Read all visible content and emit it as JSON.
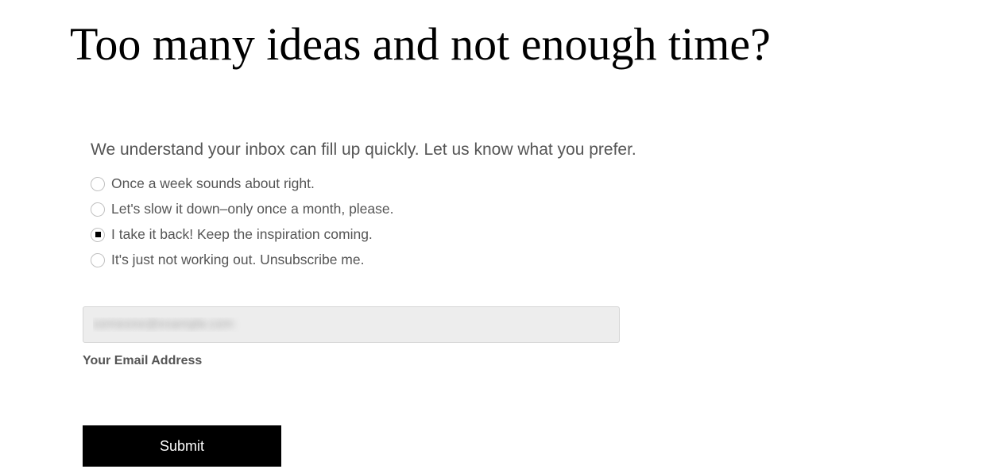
{
  "heading": "Too many ideas and not enough time?",
  "intro": "We understand your inbox can fill up quickly. Let us know what you prefer.",
  "options": [
    {
      "label": "Once a week sounds about right.",
      "selected": false
    },
    {
      "label": "Let's slow it down–only once a month, please.",
      "selected": false
    },
    {
      "label": "I take it back! Keep the inspiration coming.",
      "selected": true
    },
    {
      "label": "It's just not working out. Unsubscribe me.",
      "selected": false
    }
  ],
  "email": {
    "value": "someone@example.com",
    "label": "Your Email Address"
  },
  "submit_label": "Submit"
}
